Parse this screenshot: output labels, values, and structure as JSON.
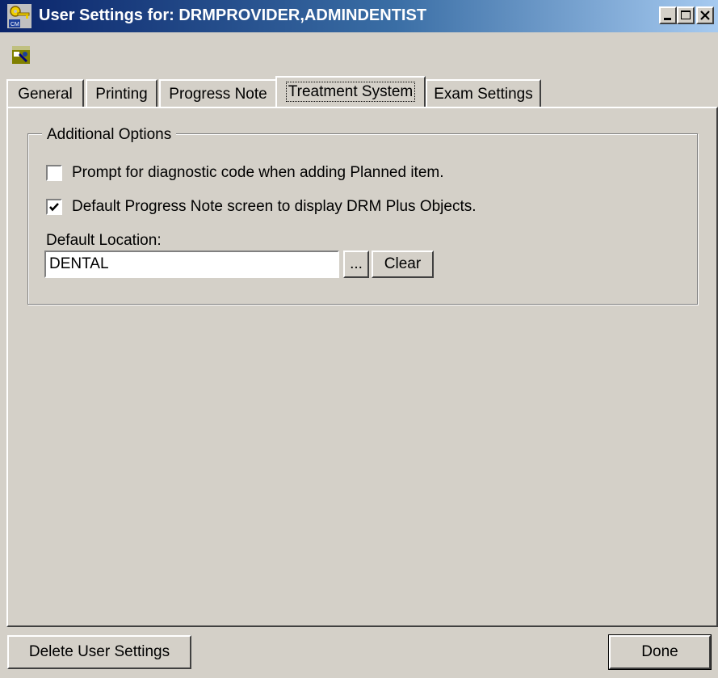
{
  "window": {
    "title": "User Settings for: DRMPROVIDER,ADMINDENTIST",
    "controls": [
      "minimize-icon",
      "maximize-icon",
      "close-icon"
    ]
  },
  "toolbar": {
    "icon": "user-settings-icon"
  },
  "tabs": [
    {
      "label": "General",
      "active": false
    },
    {
      "label": "Printing",
      "active": false
    },
    {
      "label": "Progress Note",
      "active": false
    },
    {
      "label": "Treatment System",
      "active": true
    },
    {
      "label": "Exam Settings",
      "active": false
    }
  ],
  "additional_options": {
    "title": "Additional Options",
    "prompt_diagnostic": {
      "label": "Prompt for diagnostic code when adding Planned item.",
      "checked": false
    },
    "default_drm_plus": {
      "label": "Default Progress Note screen to display DRM Plus Objects.",
      "checked": true
    },
    "default_location": {
      "label": "Default Location:",
      "value": "DENTAL",
      "browse_label": "...",
      "clear_label": "Clear"
    }
  },
  "footer": {
    "delete_label": "Delete User Settings",
    "done_label": "Done"
  }
}
